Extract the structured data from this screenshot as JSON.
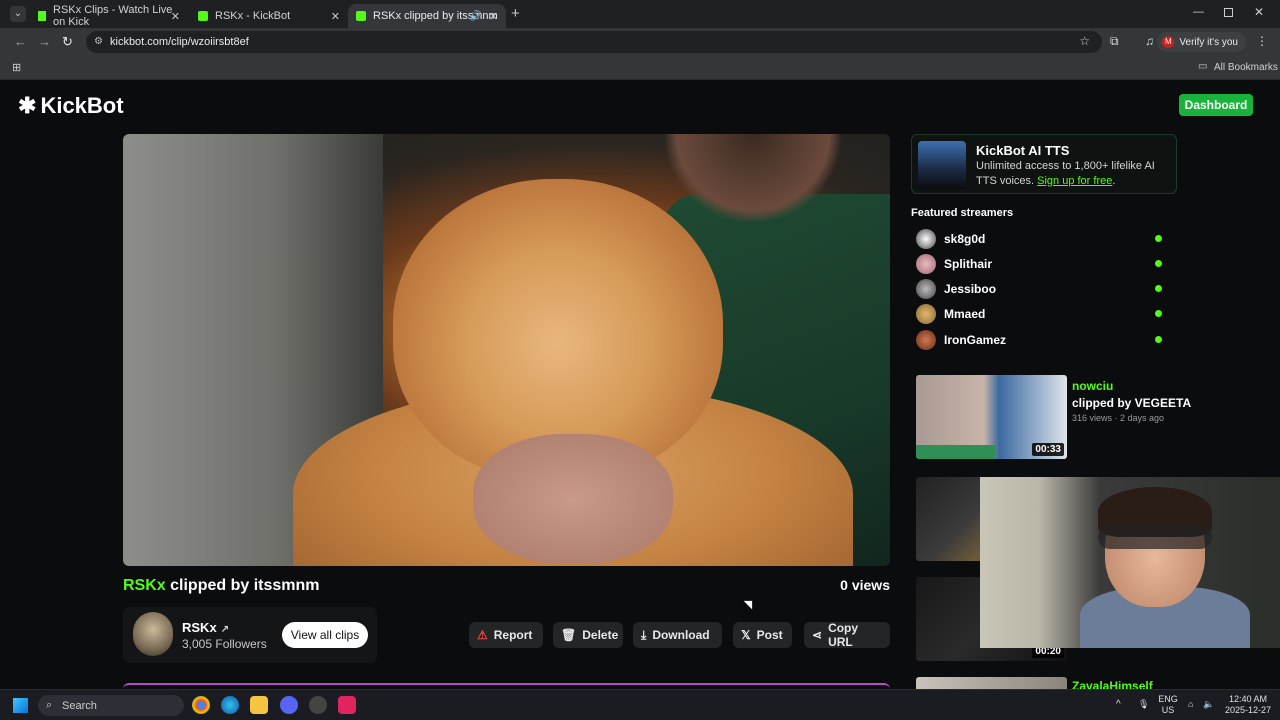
{
  "browser": {
    "tabs": [
      {
        "label": "RSKx Clips - Watch Live on Kick",
        "active": false
      },
      {
        "label": "RSKx - KickBot",
        "active": false
      },
      {
        "label": "RSKx clipped by itssmnm",
        "active": true
      }
    ],
    "url": "kickbot.com/clip/wzoiirsbt8ef",
    "verify_label": "Verify it's you",
    "verify_avatar": "M",
    "bookmarks_label": "All Bookmarks"
  },
  "site": {
    "logo": "KickBot",
    "dashboard_label": "Dashboard"
  },
  "clip": {
    "channel": "RSKx",
    "title_suffix": " clipped by itssmnm",
    "views": "0 views",
    "streamer_name": "RSKx",
    "followers": "3,005 Followers",
    "view_all_label": "View all clips",
    "actions": {
      "report": "Report",
      "delete": "Delete",
      "download": "Download",
      "post": "Post",
      "copy_url": "Copy URL"
    }
  },
  "sidebar": {
    "promo": {
      "title": "KickBot AI TTS",
      "text": "Unlimited access to 1,800+ lifelike AI TTS voices.",
      "link": "Sign up for free"
    },
    "featured_heading": "Featured streamers",
    "streamers": [
      {
        "name": "sk8g0d",
        "avatar_color": "#e8e8e8"
      },
      {
        "name": "Splithair",
        "avatar_color": "#d9a0a8"
      },
      {
        "name": "Jessiboo",
        "avatar_color": "#9a9a9a"
      },
      {
        "name": "Mmaed",
        "avatar_color": "#c8a060"
      },
      {
        "name": "IronGamez",
        "avatar_color": "#b05a3a"
      }
    ],
    "clips": [
      {
        "streamer": "nowciu",
        "clipper": "clipped by VEGEETA",
        "meta": "316 views · 2 days ago",
        "duration": "00:33"
      },
      {
        "streamer": "",
        "clipper": "",
        "meta": "",
        "duration": ""
      },
      {
        "streamer": "",
        "clipper": "",
        "meta": "",
        "duration": "00:20"
      },
      {
        "streamer": "ZavalaHimself",
        "clipper": "",
        "meta": "",
        "duration": ""
      }
    ]
  },
  "taskbar": {
    "search_placeholder": "Search",
    "lang": "ENG",
    "region": "US",
    "time": "12:40 AM",
    "date": "2025-12-27"
  }
}
